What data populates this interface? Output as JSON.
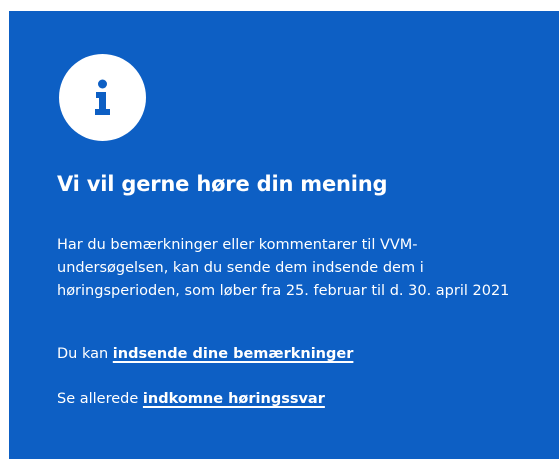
{
  "info_box": {
    "icon": "info-icon",
    "heading": "Vi vil gerne høre din mening",
    "body": "Har du bemærkninger eller kommentarer til VVM-undersøgelsen, kan du sende dem indsende dem i høringsperioden, som løber fra 25. februar til d. 30. april 2021",
    "submit_prefix": "Du kan",
    "submit_link": "indsende dine bemærkninger",
    "responses_prefix": "Se allerede",
    "responses_link": "indkomne høringssvar"
  },
  "colors": {
    "panel_background": "#0d5fc4",
    "text": "#ffffff",
    "icon_circle": "#ffffff",
    "icon_glyph": "#0d5fc4"
  }
}
